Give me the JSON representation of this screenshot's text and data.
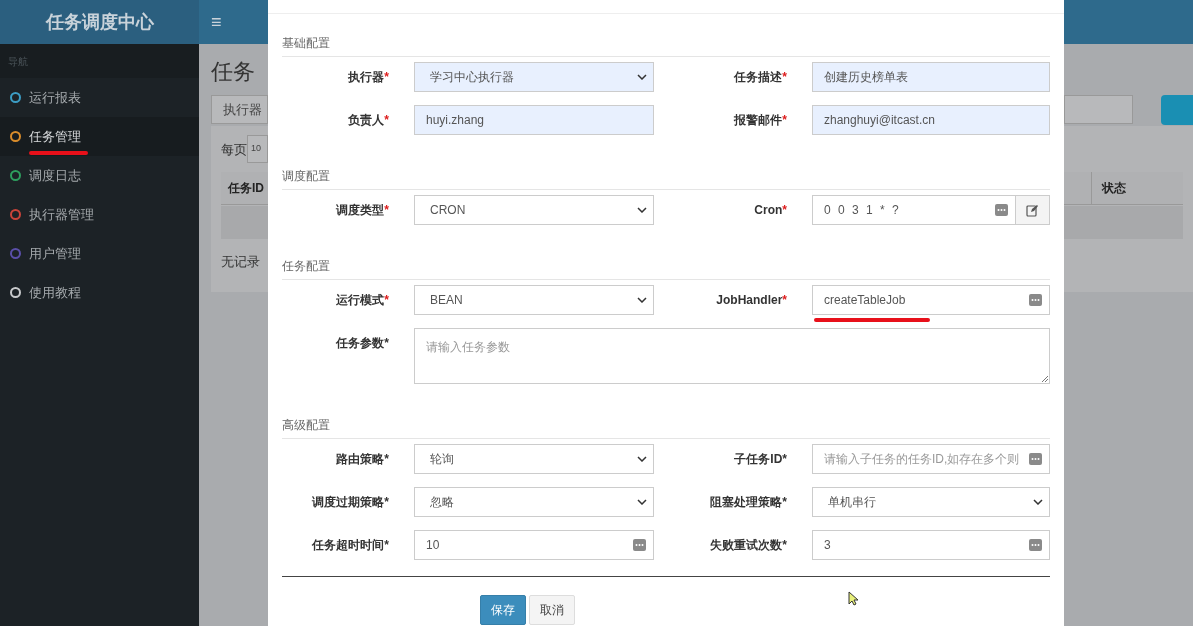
{
  "app_title": "任务调度中心",
  "menu_toggle": "≡",
  "sidebar": {
    "heading": "导航",
    "items": [
      {
        "label": "运行报表",
        "color": "#3c9dc4",
        "selected": false,
        "underlined": false
      },
      {
        "label": "任务管理",
        "color": "#d98c2b",
        "selected": true,
        "underlined": true
      },
      {
        "label": "调度日志",
        "color": "#2e9e5e",
        "selected": false,
        "underlined": false
      },
      {
        "label": "执行器管理",
        "color": "#c9443a",
        "selected": false,
        "underlined": false
      },
      {
        "label": "用户管理",
        "color": "#5a4fa8",
        "selected": false,
        "underlined": false
      },
      {
        "label": "使用教程",
        "color": "#c8cacc",
        "selected": false,
        "underlined": false
      }
    ]
  },
  "background_page": {
    "title": "任务",
    "filter_label": "执行器",
    "page_size_label": "每页",
    "page_size": "10",
    "columns": [
      "任务ID",
      "状态"
    ],
    "empty_text": "无记录"
  },
  "dialog": {
    "sections": [
      {
        "title": "基础配置",
        "rows": [
          [
            {
              "label": "执行器",
              "star": "*",
              "red_star": true,
              "kind": "select",
              "value": "学习中心执行器",
              "filled": true
            },
            {
              "label": "任务描述",
              "star": "*",
              "red_star": true,
              "kind": "input",
              "value": "创建历史榜单表",
              "filled": true
            }
          ],
          [
            {
              "label": "负责人",
              "star": "*",
              "red_star": true,
              "kind": "input",
              "value": "huyi.zhang",
              "filled": true
            },
            {
              "label": "报警邮件",
              "star": "*",
              "red_star": true,
              "kind": "input",
              "value": "zhanghuyi@itcast.cn",
              "filled": true
            }
          ]
        ]
      },
      {
        "title": "调度配置",
        "rows": [
          [
            {
              "label": "调度类型",
              "star": "*",
              "red_star": true,
              "kind": "select",
              "value": "CRON",
              "filled": false
            },
            {
              "label": "Cron",
              "star": "*",
              "red_star": true,
              "kind": "cron",
              "value": "0 0 3 1 * ?",
              "filled": false
            }
          ]
        ]
      },
      {
        "title": "任务配置",
        "rows": [
          [
            {
              "label": "运行模式",
              "star": "*",
              "red_star": true,
              "kind": "select",
              "value": "BEAN",
              "filled": false
            },
            {
              "label": "JobHandler",
              "star": "*",
              "red_star": true,
              "kind": "input",
              "value": "createTableJob",
              "filled": false,
              "underlined": true
            }
          ],
          [
            {
              "label": "任务参数",
              "star": "*",
              "red_star": false,
              "kind": "textarea",
              "placeholder": "请输入任务参数",
              "filled": false
            }
          ]
        ]
      },
      {
        "title": "高级配置",
        "rows": [
          [
            {
              "label": "路由策略",
              "star": "*",
              "red_star": false,
              "kind": "select",
              "value": "轮询",
              "filled": false
            },
            {
              "label": "子任务ID",
              "star": "*",
              "red_star": false,
              "kind": "input",
              "placeholder": "请输入子任务的任务ID,如存在多个则",
              "filled": false
            }
          ],
          [
            {
              "label": "调度过期策略",
              "star": "*",
              "red_star": false,
              "kind": "select",
              "value": "忽略",
              "filled": false
            },
            {
              "label": "阻塞处理策略",
              "star": "*",
              "red_star": false,
              "kind": "select",
              "value": "单机串行",
              "filled": false
            }
          ],
          [
            {
              "label": "任务超时时间",
              "star": "*",
              "red_star": false,
              "kind": "input",
              "value": "10",
              "filled": false
            },
            {
              "label": "失败重试次数",
              "star": "*",
              "red_star": false,
              "kind": "input",
              "value": "3",
              "filled": false
            }
          ]
        ]
      }
    ],
    "buttons": [
      {
        "label": "保存",
        "kind": "primary"
      },
      {
        "label": "取消",
        "kind": "default"
      }
    ]
  }
}
